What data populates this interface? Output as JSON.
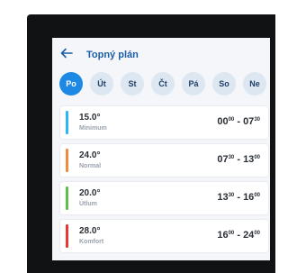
{
  "colors": {
    "accent": "#1e88e5",
    "title": "#1c5fa8",
    "minimum": "#29b6f6",
    "normal": "#f08a3c",
    "utlum": "#5cc04a",
    "komfort": "#e53935"
  },
  "header": {
    "title": "Topný plán",
    "back_icon": "arrow-left-icon"
  },
  "days": [
    "Po",
    "Út",
    "St",
    "Čt",
    "Pá",
    "So",
    "Ne"
  ],
  "selected_day": "Po",
  "schedule": [
    {
      "temp": "15.0°",
      "mode": "Minimum",
      "from_h": "00",
      "from_m": "00",
      "to_h": "07",
      "to_m": "30"
    },
    {
      "temp": "24.0°",
      "mode": "Normal",
      "from_h": "07",
      "from_m": "30",
      "to_h": "13",
      "to_m": "00"
    },
    {
      "temp": "20.0°",
      "mode": "Útlum",
      "from_h": "13",
      "from_m": "30",
      "to_h": "16",
      "to_m": "00"
    },
    {
      "temp": "28.0°",
      "mode": "Komfort",
      "from_h": "16",
      "from_m": "00",
      "to_h": "24",
      "to_m": "00"
    }
  ]
}
